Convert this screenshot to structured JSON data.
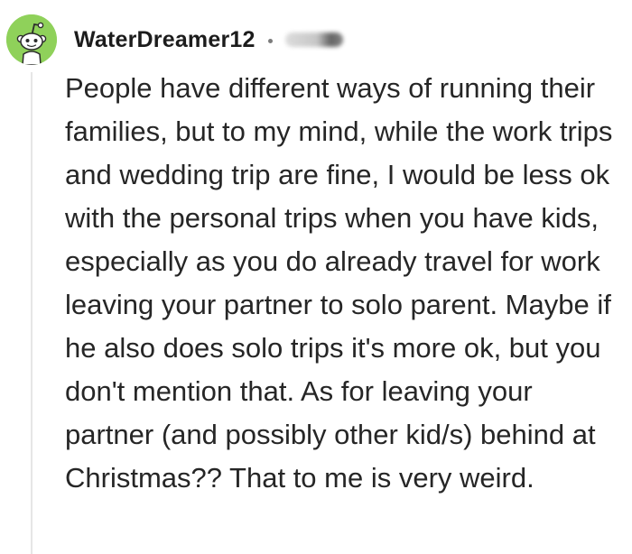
{
  "comment": {
    "avatar_icon": "reddit-snoo-avatar-icon",
    "avatar_color": "#8fd15a",
    "username": "WaterDreamer12",
    "separator": "•",
    "timestamp_obscured": true,
    "body": "People have different ways of running their families, but to my mind, while the work trips and wedding trip are fine, I would be less ok with the personal trips when you have kids, especially as you do already travel for work leaving your partner to solo parent. Maybe if he also does solo trips it's more ok, but you don't mention that. As for leaving your partner (and possibly other kid/s) behind at Christmas?? That to me is very weird."
  }
}
